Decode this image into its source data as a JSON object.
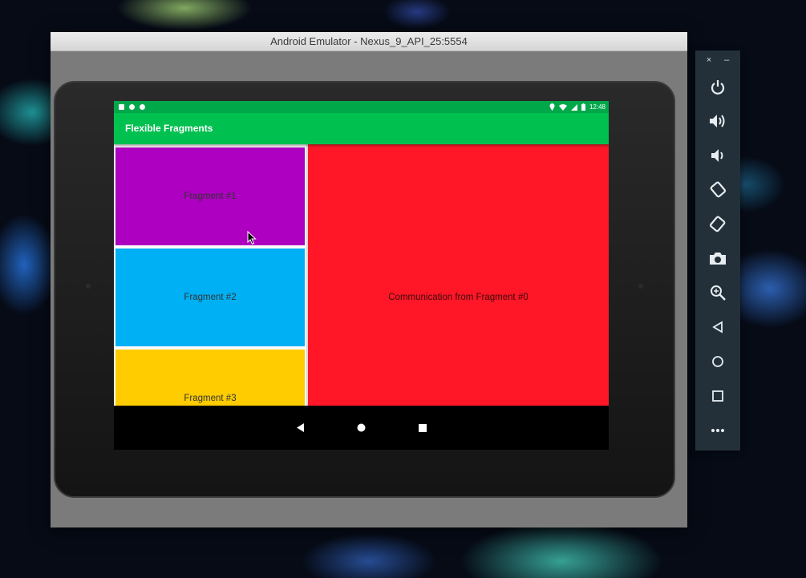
{
  "window": {
    "title": "Android Emulator - Nexus_9_API_25:5554"
  },
  "statusbar": {
    "time": "12:48"
  },
  "app": {
    "title": "Flexible Fragments",
    "fragments": [
      {
        "label": "Fragment #1",
        "color": "#ad00c0"
      },
      {
        "label": "Fragment #2",
        "color": "#00b0f5"
      },
      {
        "label": "Fragment #3",
        "color": "#ffcc00"
      }
    ],
    "detail": {
      "text": "Communication from Fragment #0",
      "color": "#ff1728"
    }
  },
  "toolbar": {
    "close": "×",
    "minimize": "–",
    "items": [
      "power",
      "volume-up",
      "volume-down",
      "rotate-left",
      "rotate-right",
      "screenshot",
      "zoom",
      "back",
      "home",
      "overview",
      "more"
    ]
  },
  "colors": {
    "status_green": "#00a84a",
    "appbar_green": "#00c050",
    "toolbar_bg": "#23303a"
  }
}
